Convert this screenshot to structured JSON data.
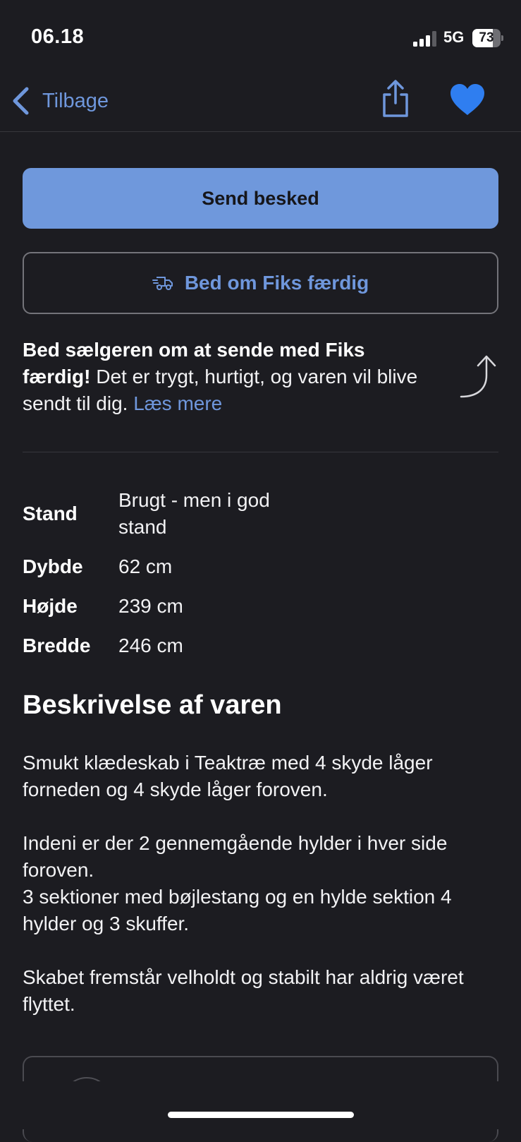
{
  "status_bar": {
    "time": "06.18",
    "network": "5G",
    "battery": "73",
    "battery_level": 0.73
  },
  "nav": {
    "back_label": "Tilbage",
    "share_icon": "share-icon",
    "favorite_icon": "heart-icon",
    "accent_color": "#6f97dc"
  },
  "actions": {
    "send_message_label": "Send besked",
    "fiks_label": "Bed om Fiks færdig",
    "fiks_icon": "delivery-truck-icon"
  },
  "info": {
    "bold_text": "Bed sælgeren om at sende med Fiks færdig!",
    "text": " Det er trygt, hurtigt, og varen vil blive sendt til dig. ",
    "link": "Læs mere"
  },
  "specs": [
    {
      "key": "Stand",
      "value": "Brugt - men i god stand"
    },
    {
      "key": "Dybde",
      "value": "62 cm"
    },
    {
      "key": "Højde",
      "value": "239 cm"
    },
    {
      "key": "Bredde",
      "value": "246 cm"
    }
  ],
  "description": {
    "title": "Beskrivelse af varen",
    "paragraphs": [
      "Smukt klædeskab i Teaktræ med 4 skyde låger forneden og 4 skyde låger foroven.",
      "Indeni er der 2 gennemgående hylder i hver side foroven.\n3 sektioner med bøjlestang og en hylde sektion 4 hylder og 3 skuffer.",
      "Skabet fremstår velholdt og stabilt har aldrig været flyttet."
    ]
  }
}
